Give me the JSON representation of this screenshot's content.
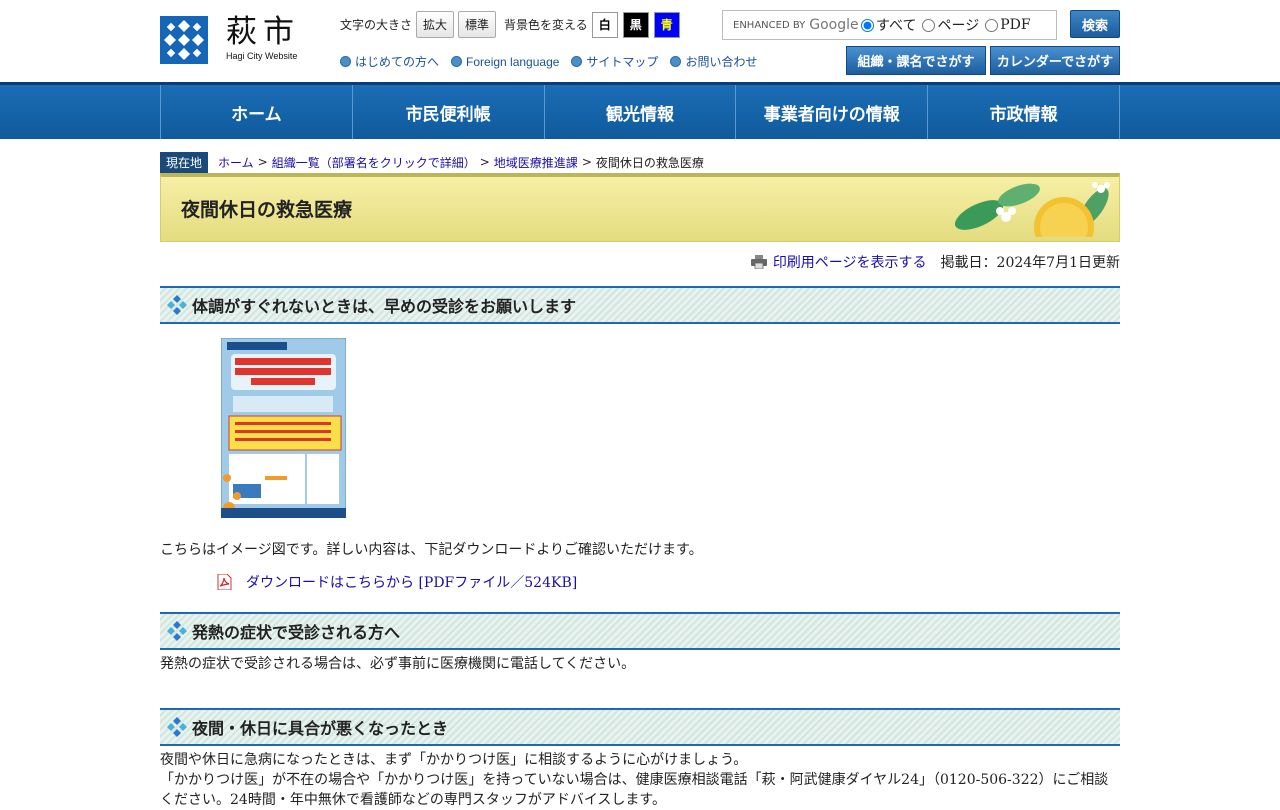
{
  "logo": {
    "jp": "萩市",
    "en": "Hagi City Website"
  },
  "tools": {
    "font_label": "文字の大きさ",
    "font_large": "拡大",
    "font_normal": "標準",
    "bg_label": "背景色を変える",
    "bg_white": "白",
    "bg_black": "黒",
    "bg_blue": "青",
    "colors": {
      "white": "#ffffff",
      "black": "#000000",
      "blue": "#0000ff",
      "blue_text": "#ffff00"
    }
  },
  "quick_links": [
    "はじめての方へ",
    "Foreign language",
    "サイトマップ",
    "お問い合わせ"
  ],
  "search": {
    "google_label": "ENHANCED BY",
    "google_brand": "Google",
    "options": [
      "すべて",
      "ページ",
      "PDF"
    ],
    "button": "検索"
  },
  "header_buttons": {
    "org": "組織・課名でさがす",
    "calendar": "カレンダーでさがす"
  },
  "nav": [
    "ホーム",
    "市民便利帳",
    "観光情報",
    "事業者向けの情報",
    "市政情報"
  ],
  "breadcrumb": {
    "label": "現在地",
    "items": [
      "ホーム",
      "組織一覧（部署名をクリックで詳細）",
      "地域医療推進課"
    ],
    "current": "夜間休日の救急医療"
  },
  "page": {
    "title": "夜間休日の救急医療",
    "print_link": "印刷用ページを表示する",
    "updated": "掲載日：2024年7月1日更新"
  },
  "sections": {
    "s1": {
      "heading": "体調がすぐれないときは、早めの受診をお願いします",
      "image_note": "こちらはイメージ図です。詳しい内容は、下記ダウンロードよりご確認いただけます。",
      "download": "ダウンロードはこちらから [PDFファイル／524KB]"
    },
    "s2": {
      "heading": "発熱の症状で受診される方へ",
      "text": "発熱の症状で受診される場合は、必ず事前に医療機関に電話してください。"
    },
    "s3": {
      "heading": "夜間・休日に具合が悪くなったとき",
      "line1": "夜間や休日に急病になったときは、まず「かかりつけ医」に相談するように心がけましょう。",
      "line2": "「かかりつけ医」が不在の場合や「かかりつけ医」を持っていない場合は、健康医療相談電話「萩・阿武健康ダイヤル24」（0120-506-322）にご相談ください。24時間・年中無休で看護師などの専門スタッフがアドバイスします。"
    }
  }
}
